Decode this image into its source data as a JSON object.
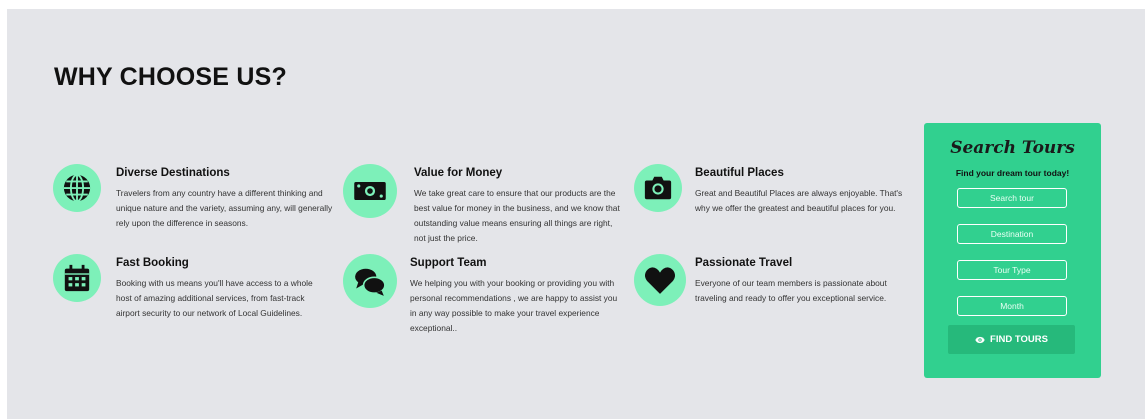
{
  "section": {
    "heading": "WHY CHOOSE US?"
  },
  "features": [
    {
      "icon": "globe-icon",
      "title": "Diverse Destinations",
      "description": "Travelers from any country have a different thinking and unique nature and the variety, assuming any, will generally rely upon the difference in seasons."
    },
    {
      "icon": "money-icon",
      "title": "Value for Money",
      "description": "We take great care to ensure that our products are the best value for money in the business, and we know that outstanding value means ensuring all things are right, not just the price."
    },
    {
      "icon": "camera-icon",
      "title": "Beautiful Places",
      "description": "Great and Beautiful Places are always enjoyable. That's why we offer the greatest and beautiful places for you."
    },
    {
      "icon": "calendar-icon",
      "title": "Fast Booking",
      "description": "Booking with us means you'll have access to a whole host of amazing additional services, from fast-track airport security to our network of Local Guidelines."
    },
    {
      "icon": "chat-icon",
      "title": "Support Team",
      "description": "We helping you with your booking or providing you with personal recommendations , we are happy to assist you in any way possible to make your travel experience exceptional.."
    },
    {
      "icon": "heart-icon",
      "title": "Passionate Travel",
      "description": "Everyone of our team members is passionate about traveling and ready to offer you exceptional service."
    }
  ],
  "search_panel": {
    "title": "Search Tours",
    "subtitle": "Find your dream tour today!",
    "fields": {
      "search_placeholder": "Search tour",
      "destination_placeholder": "Destination",
      "tour_type_placeholder": "Tour Type",
      "month_placeholder": "Month"
    },
    "button_label": "FIND TOURS",
    "button_icon": "eye-icon"
  },
  "colors": {
    "background": "#e4e5e9",
    "accent": "#31d08f",
    "accent_dark": "#26b97b",
    "icon_circle": "#7df0b9"
  }
}
